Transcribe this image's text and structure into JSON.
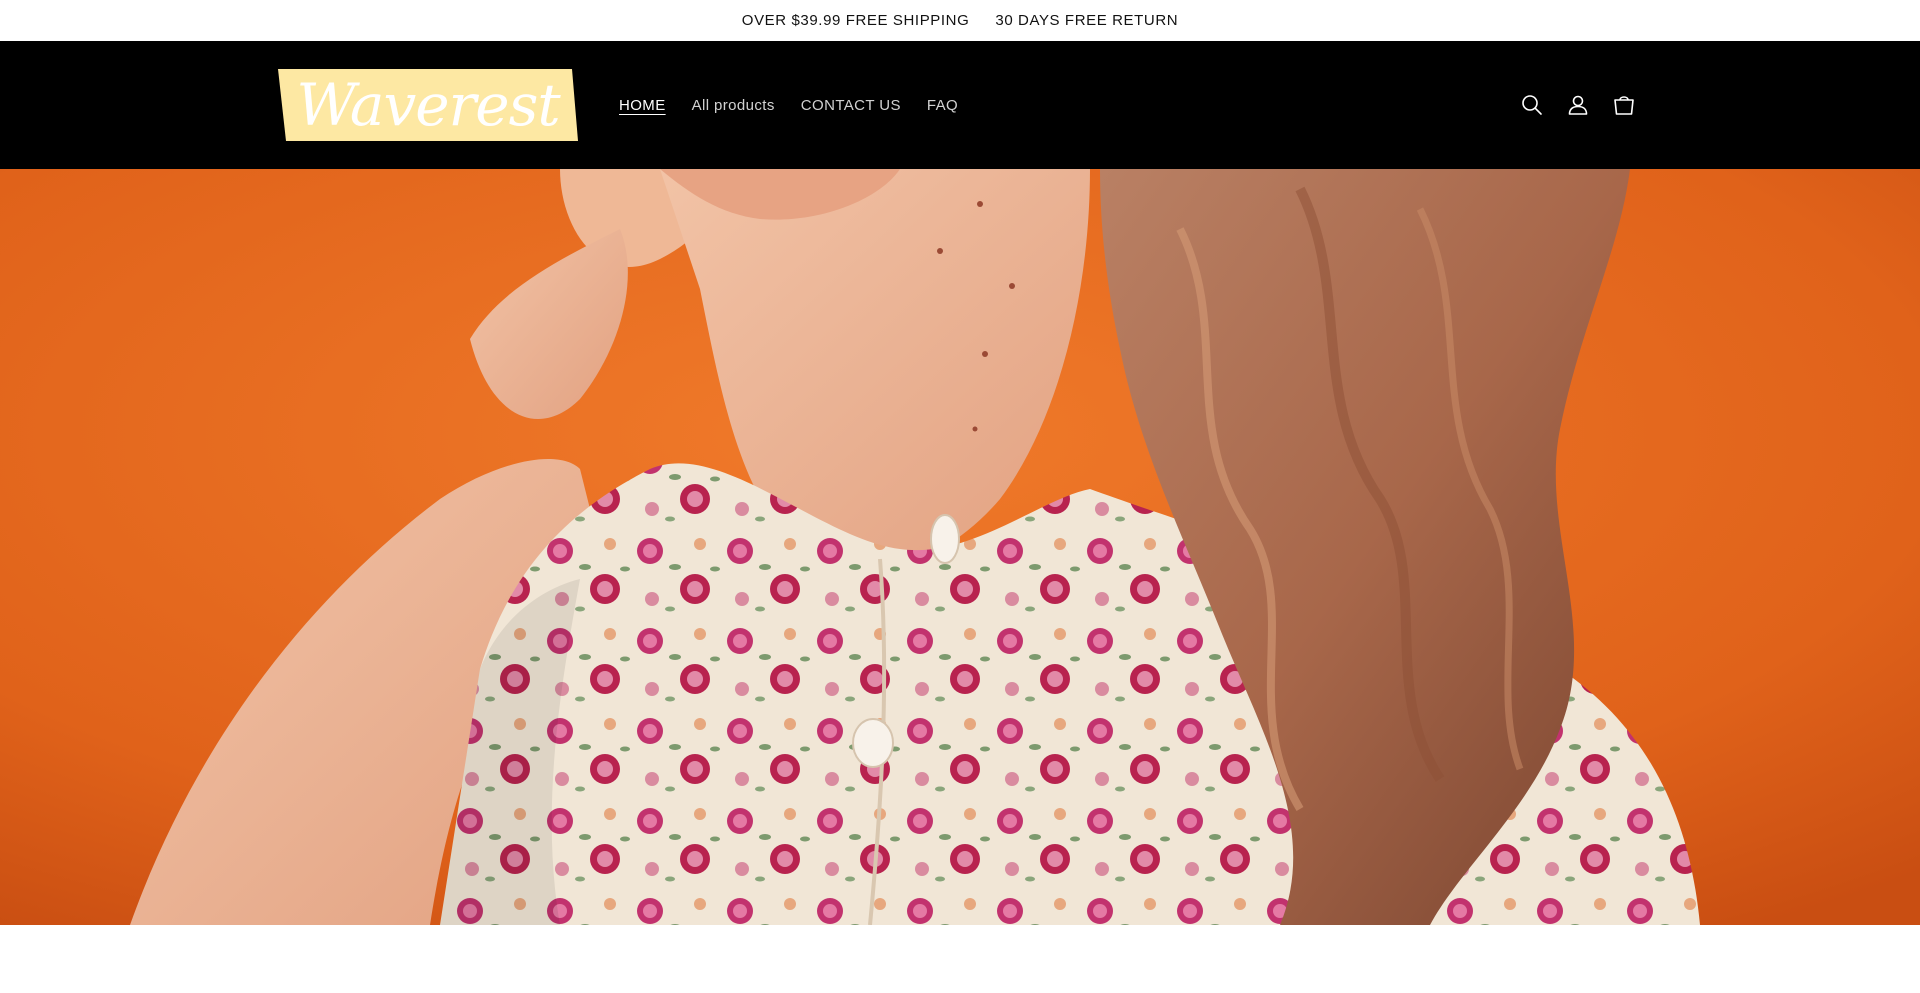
{
  "announcement": {
    "items": [
      "OVER $39.99 FREE SHIPPING",
      "30 DAYS FREE RETURN"
    ]
  },
  "header": {
    "logo_text": "Waverest",
    "nav": [
      {
        "label": "HOME",
        "active": true
      },
      {
        "label": "All products",
        "active": false
      },
      {
        "label": "CONTACT US",
        "active": false
      },
      {
        "label": "FAQ",
        "active": false
      }
    ],
    "icons": [
      "search-icon",
      "account-icon",
      "cart-icon"
    ]
  },
  "hero": {
    "image": "woman-in-floral-blouse-orange-background"
  },
  "colors": {
    "header_bg": "#000000",
    "logo_bg": "#fde8a3",
    "logo_text": "#ffffff",
    "hero_bg": "#e2681c"
  }
}
